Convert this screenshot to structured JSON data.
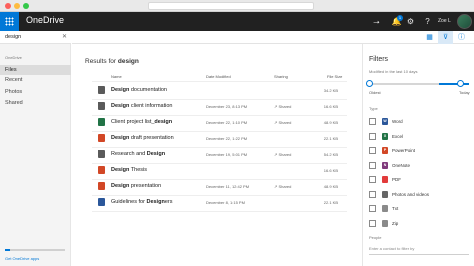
{
  "app": {
    "title": "OneDrive",
    "user_name": "Zoe L",
    "notification_count": "1"
  },
  "search": {
    "query": "design",
    "clear_icon": "close-icon"
  },
  "nav": {
    "section_label": "OneDrive",
    "items": [
      "Files",
      "Recent",
      "Photos",
      "Shared"
    ],
    "selected": "Files",
    "storage_fraction": 0.08,
    "get_apps": "Get OneDrive apps"
  },
  "results": {
    "prefix": "Results for",
    "query": "design",
    "columns": {
      "name": "Name",
      "date": "Date Modified",
      "sharing": "Sharing",
      "size": "File Size"
    },
    "rows": [
      {
        "pre": "",
        "bold": "Design",
        "post": " documentation",
        "date": "",
        "sharing": "",
        "size": "34.2 KB",
        "icon": "folder-icon",
        "color": "#5a5a5a"
      },
      {
        "pre": "",
        "bold": "Design",
        "post": " client information",
        "date": "December 23, 8:13 PM",
        "sharing": "Shared",
        "size": "16.6 KB",
        "icon": "folder-icon",
        "color": "#5a5a5a"
      },
      {
        "pre": "Client project list_",
        "bold": "design",
        "post": "",
        "date": "December 22, 1:10 PM",
        "sharing": "Shared",
        "size": "48.9 KB",
        "icon": "excel-icon",
        "color": "#217346"
      },
      {
        "pre": "",
        "bold": "Design",
        "post": " draft presentation",
        "date": "December 22, 1:22 PM",
        "sharing": "",
        "size": "22.1 KB",
        "icon": "powerpoint-icon",
        "color": "#d24726"
      },
      {
        "pre": "Research and ",
        "bold": "Design",
        "post": "",
        "date": "December 19, 5:01 PM",
        "sharing": "Shared",
        "size": "54.2 KB",
        "icon": "folder-icon",
        "color": "#5a5a5a"
      },
      {
        "pre": "",
        "bold": "Design",
        "post": " Thesis",
        "date": "",
        "sharing": "",
        "size": "16.6 KB",
        "icon": "onenote-icon",
        "color": "#d24726"
      },
      {
        "pre": "",
        "bold": "Design",
        "post": " presentation",
        "date": "December 11, 12:42 PM",
        "sharing": "Shared",
        "size": "48.9 KB",
        "icon": "powerpoint-icon",
        "color": "#d24726"
      },
      {
        "pre": "Guidelines for ",
        "bold": "Design",
        "post": "ers",
        "date": "December 8, 1:15 PM",
        "sharing": "",
        "size": "22.1 KB",
        "icon": "word-icon",
        "color": "#2b579a"
      }
    ]
  },
  "filters": {
    "title": "Filters",
    "modified_label": "Modified in the last 10 days",
    "slider_value": 0.92,
    "oldest": "Oldest",
    "today": "Today",
    "type_label": "Type",
    "types": [
      {
        "label": "Word",
        "icon": "word-icon",
        "color": "#2b579a",
        "letter": "W"
      },
      {
        "label": "Excel",
        "icon": "excel-icon",
        "color": "#217346",
        "letter": "X"
      },
      {
        "label": "PowerPoint",
        "icon": "powerpoint-icon",
        "color": "#d24726",
        "letter": "P"
      },
      {
        "label": "OneNote",
        "icon": "onenote-icon",
        "color": "#80397b",
        "letter": "N"
      },
      {
        "label": "PDF",
        "icon": "pdf-icon",
        "color": "#e23b3b",
        "letter": ""
      },
      {
        "label": "Photos and videos",
        "icon": "photo-icon",
        "color": "#666666",
        "letter": ""
      },
      {
        "label": "Txt",
        "icon": "text-file-icon",
        "color": "#8a8a8a",
        "letter": ""
      },
      {
        "label": "Zip",
        "icon": "zip-icon",
        "color": "#8a8a8a",
        "letter": ""
      }
    ],
    "people_label": "People",
    "people_placeholder": "Enter a contact to filter by"
  },
  "colors": {
    "accent": "#0078d7",
    "appbar": "#212121"
  }
}
